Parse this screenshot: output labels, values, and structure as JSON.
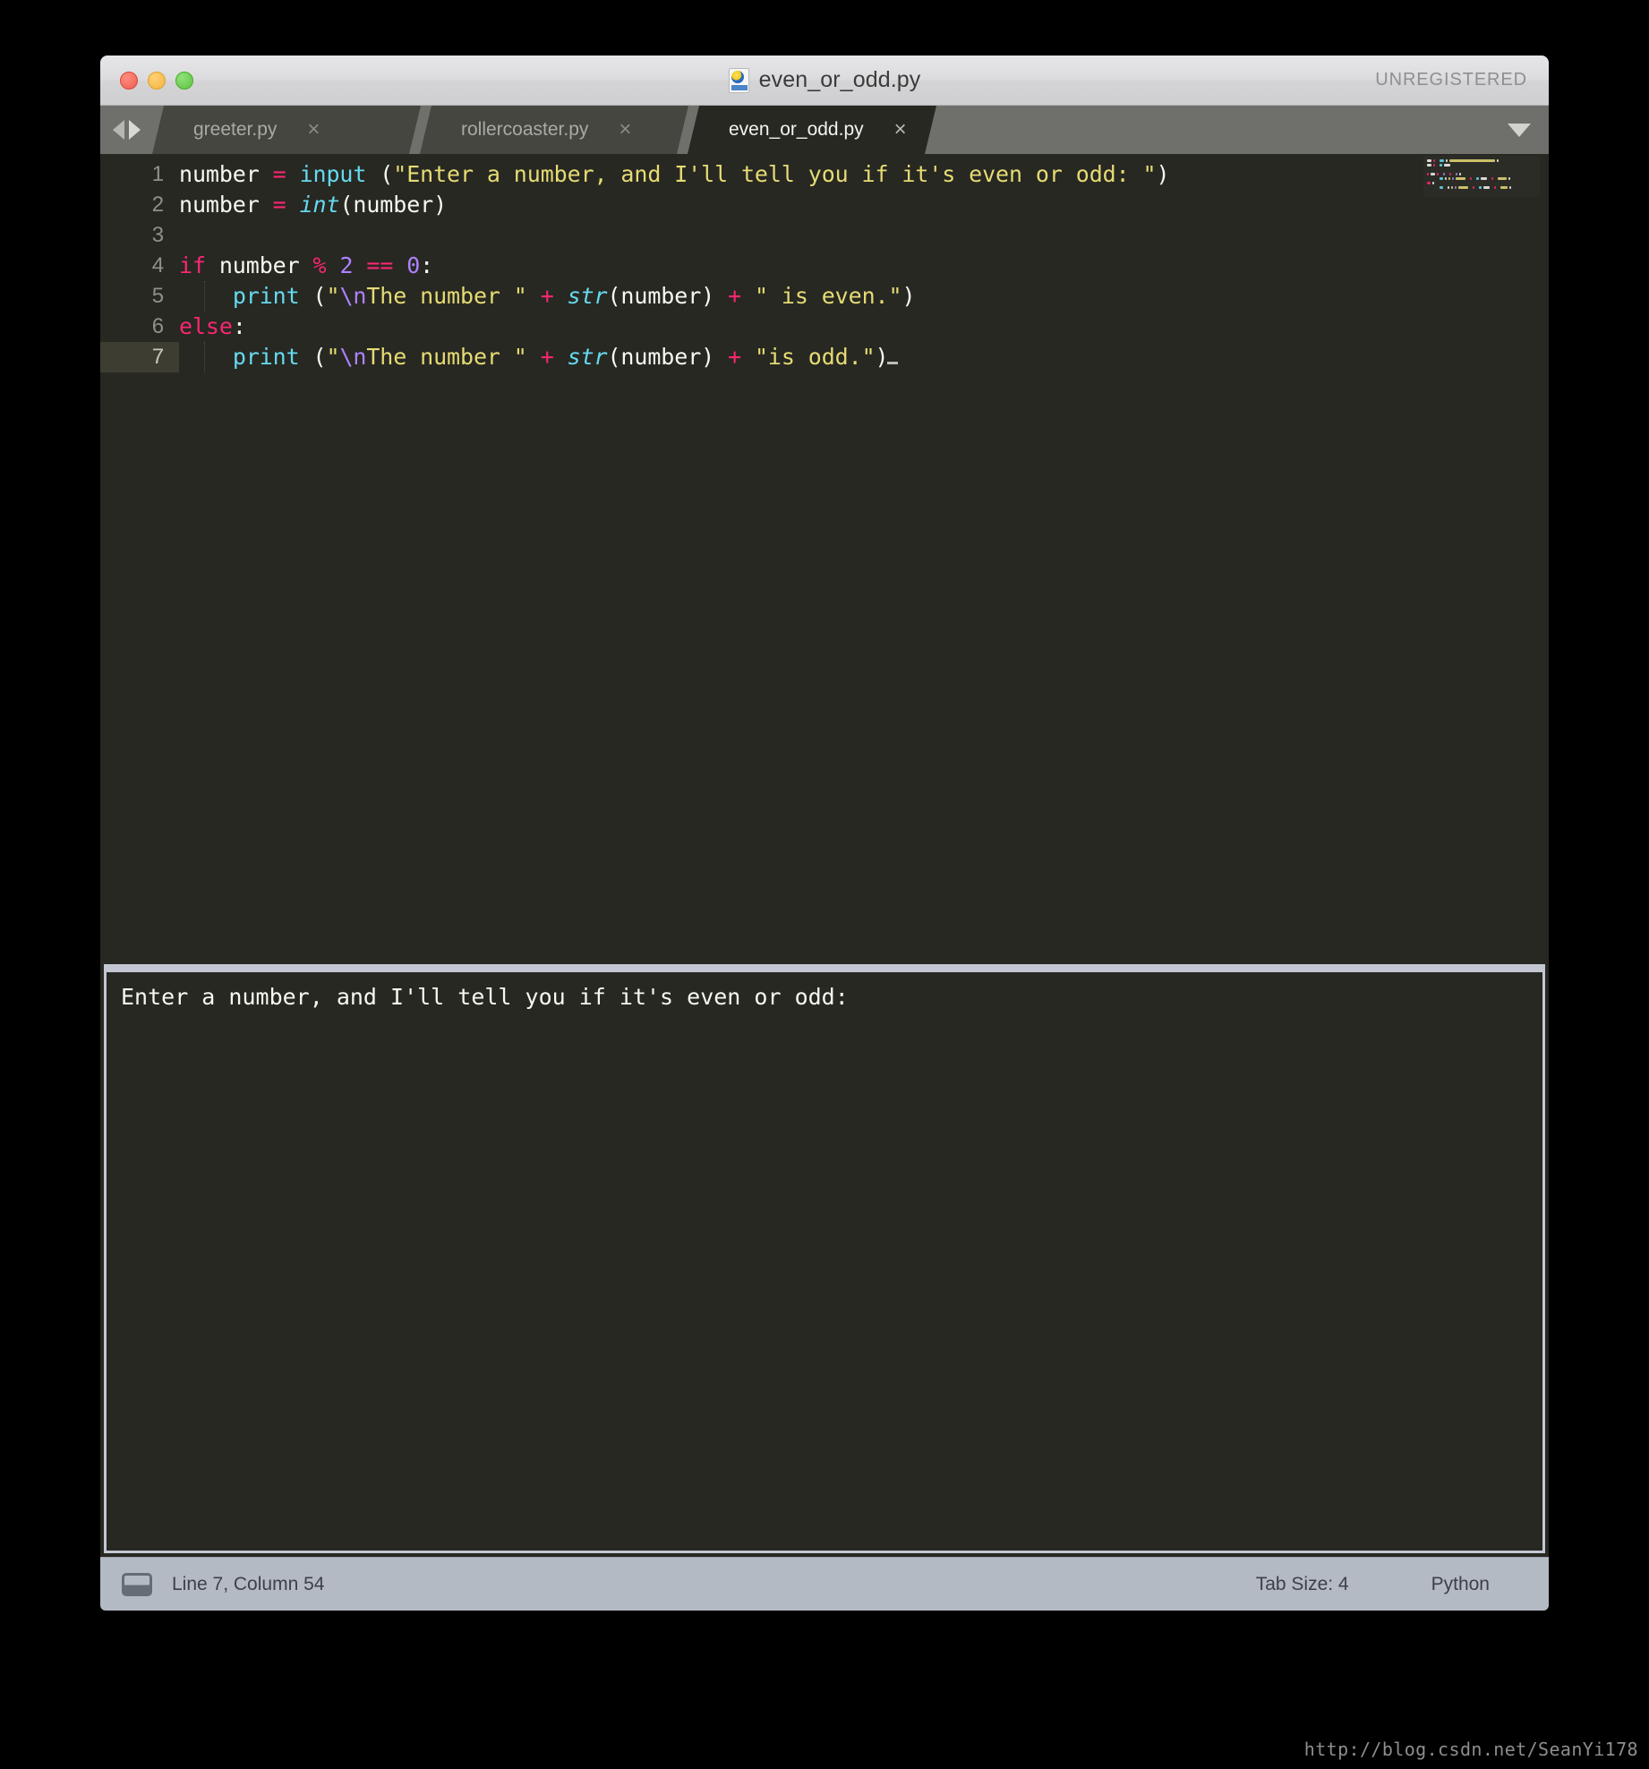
{
  "window": {
    "title": "even_or_odd.py",
    "license_status": "UNREGISTERED",
    "doc_icon": "python-file-icon"
  },
  "traffic_lights": {
    "close": "close-window-button",
    "minimize": "minimize-window-button",
    "zoom": "zoom-window-button"
  },
  "tabbar": {
    "nav_prev": "previous-tab-arrow",
    "nav_next": "next-tab-arrow",
    "menu_icon": "tab-overflow-caret",
    "close_glyph": "×",
    "tabs": [
      {
        "label": "greeter.py",
        "active": false
      },
      {
        "label": "rollercoaster.py",
        "active": false
      },
      {
        "label": "even_or_odd.py",
        "active": true
      }
    ]
  },
  "editor": {
    "language": "Python",
    "lines": [
      {
        "number": "1",
        "tokens": [
          {
            "t": "number ",
            "c": "plain"
          },
          {
            "t": "=",
            "c": "op"
          },
          {
            "t": " ",
            "c": "plain"
          },
          {
            "t": "input",
            "c": "fn"
          },
          {
            "t": " (",
            "c": "punct"
          },
          {
            "t": "\"Enter a number, and I'll tell you if it's even or odd: \"",
            "c": "str"
          },
          {
            "t": ")",
            "c": "punct"
          }
        ]
      },
      {
        "number": "2",
        "tokens": [
          {
            "t": "number ",
            "c": "plain"
          },
          {
            "t": "=",
            "c": "op"
          },
          {
            "t": " ",
            "c": "plain"
          },
          {
            "t": "int",
            "c": "type"
          },
          {
            "t": "(number)",
            "c": "punct"
          }
        ]
      },
      {
        "number": "3",
        "tokens": []
      },
      {
        "number": "4",
        "tokens": [
          {
            "t": "if",
            "c": "kw"
          },
          {
            "t": " number ",
            "c": "plain"
          },
          {
            "t": "%",
            "c": "op"
          },
          {
            "t": " ",
            "c": "plain"
          },
          {
            "t": "2",
            "c": "num"
          },
          {
            "t": " ",
            "c": "plain"
          },
          {
            "t": "==",
            "c": "op"
          },
          {
            "t": " ",
            "c": "plain"
          },
          {
            "t": "0",
            "c": "num"
          },
          {
            "t": ":",
            "c": "punct"
          }
        ]
      },
      {
        "number": "5",
        "indent": true,
        "tokens": [
          {
            "t": "    ",
            "c": "plain"
          },
          {
            "t": "print",
            "c": "fn"
          },
          {
            "t": " (",
            "c": "punct"
          },
          {
            "t": "\"",
            "c": "str"
          },
          {
            "t": "\\n",
            "c": "esc"
          },
          {
            "t": "The number \"",
            "c": "str"
          },
          {
            "t": " ",
            "c": "plain"
          },
          {
            "t": "+",
            "c": "op"
          },
          {
            "t": " ",
            "c": "plain"
          },
          {
            "t": "str",
            "c": "type"
          },
          {
            "t": "(number)",
            "c": "punct"
          },
          {
            "t": " ",
            "c": "plain"
          },
          {
            "t": "+",
            "c": "op"
          },
          {
            "t": " ",
            "c": "plain"
          },
          {
            "t": "\" is even.\"",
            "c": "str"
          },
          {
            "t": ")",
            "c": "punct"
          }
        ]
      },
      {
        "number": "6",
        "tokens": [
          {
            "t": "else",
            "c": "kw"
          },
          {
            "t": ":",
            "c": "punct"
          }
        ]
      },
      {
        "number": "7",
        "active": true,
        "indent": true,
        "tokens": [
          {
            "t": "    ",
            "c": "plain"
          },
          {
            "t": "print",
            "c": "fn"
          },
          {
            "t": " ",
            "c": "punct"
          },
          {
            "t": "(",
            "c": "punct"
          },
          {
            "t": "\"",
            "c": "str"
          },
          {
            "t": "\\n",
            "c": "esc"
          },
          {
            "t": "The number \"",
            "c": "str"
          },
          {
            "t": " ",
            "c": "plain"
          },
          {
            "t": "+",
            "c": "op"
          },
          {
            "t": " ",
            "c": "plain"
          },
          {
            "t": "str",
            "c": "type"
          },
          {
            "t": "(number)",
            "c": "punct"
          },
          {
            "t": " ",
            "c": "plain"
          },
          {
            "t": "+",
            "c": "op"
          },
          {
            "t": " ",
            "c": "plain"
          },
          {
            "t": "\"is odd.\"",
            "c": "str"
          },
          {
            "t": ")",
            "c": "punct"
          }
        ]
      }
    ]
  },
  "minimap": {
    "name": "code-minimap"
  },
  "console": {
    "output": "Enter a number, and I'll tell you if it's even or odd:"
  },
  "statusbar": {
    "sidebar_icon": "toggle-console-icon",
    "cursor_position": "Line 7, Column 54",
    "tab_size": "Tab Size: 4",
    "syntax": "Python"
  },
  "watermark": {
    "text": "http://blog.csdn.net/SeanYi178"
  },
  "colors": {
    "editor_bg": "#272822",
    "active_line": "#3e3d32",
    "tab_inactive": "#45463f",
    "tabbar_bg": "#6f706b",
    "titlebar_bg": "#dcdcde",
    "statusbar_bg": "#b4bac4",
    "string": "#e6db74",
    "keyword": "#f92672",
    "function": "#66d9ef",
    "number_literal": "#ae81ff",
    "plain_text": "#f8f8f2"
  }
}
